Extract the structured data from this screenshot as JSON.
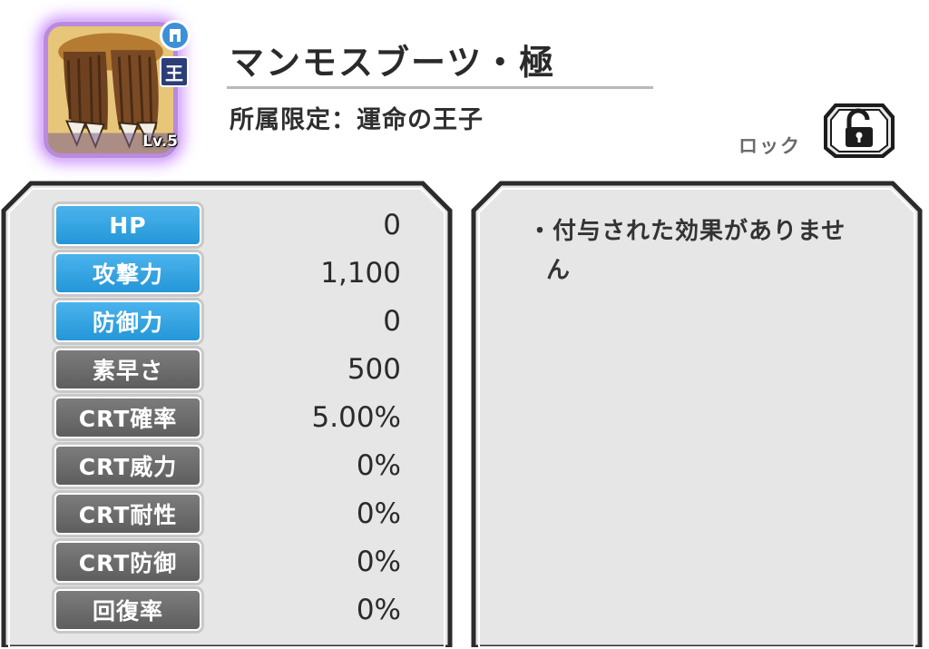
{
  "item": {
    "name": "マンモスブーツ・極",
    "affiliation": "所属限定：運命の王子",
    "level": "Lv.5",
    "king_badge": "王",
    "type_icon": "boots-icon",
    "frame_glow_color": "#c77dff"
  },
  "lock": {
    "label": "ロック",
    "icon": "unlocked-padlock-icon"
  },
  "stats": [
    {
      "label": "HP",
      "value": "0",
      "style": "blue"
    },
    {
      "label": "攻撃力",
      "value": "1,100",
      "style": "blue"
    },
    {
      "label": "防御力",
      "value": "0",
      "style": "blue"
    },
    {
      "label": "素早さ",
      "value": "500",
      "style": "gray"
    },
    {
      "label": "CRT確率",
      "value": "5.00%",
      "style": "gray"
    },
    {
      "label": "CRT威力",
      "value": "0%",
      "style": "gray"
    },
    {
      "label": "CRT耐性",
      "value": "0%",
      "style": "gray"
    },
    {
      "label": "CRT防御",
      "value": "0%",
      "style": "gray"
    },
    {
      "label": "回復率",
      "value": "0%",
      "style": "gray"
    }
  ],
  "effects": {
    "text": "・付与された効果がありません"
  },
  "colors": {
    "blue_label": "#2496d8",
    "gray_label": "#6a6a6a",
    "panel_bg": "#e6e6e6",
    "panel_border": "#2b2b2b"
  }
}
